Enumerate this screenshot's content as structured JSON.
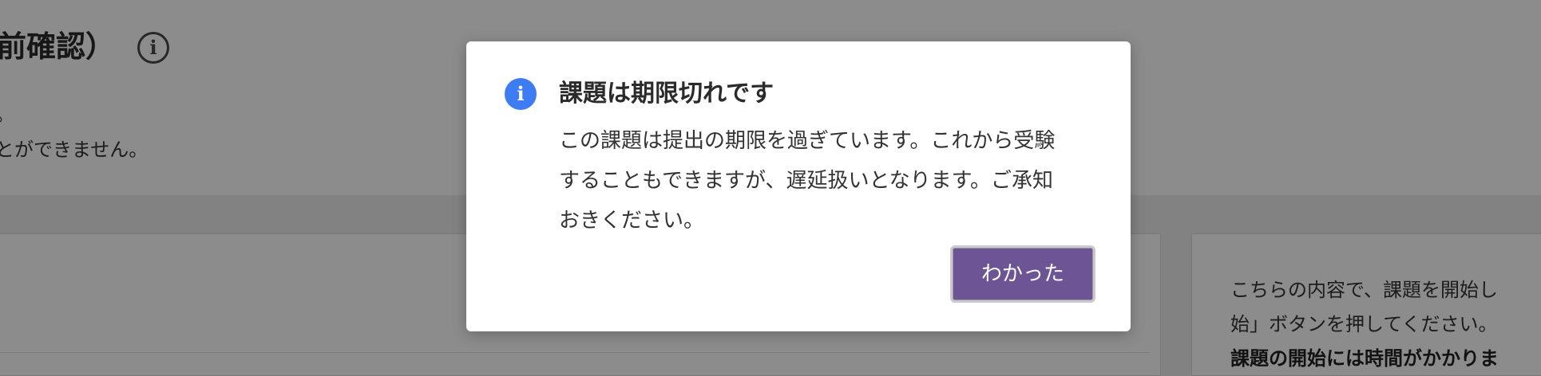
{
  "page": {
    "title": "前確認）",
    "header_line_1": "。",
    "header_line_2": "とができません。",
    "right_panel": {
      "line_1": "こちらの内容で、課題を開始し",
      "line_2": "始」ボタンを押してください。",
      "line_3": "課題の開始には時間がかかりま"
    }
  },
  "modal": {
    "icon": "info-icon",
    "title": "課題は期限切れです",
    "body_lines": [
      "この課題は提出の期限を過ぎています。これから受験",
      "することもできますが、遅延扱いとなります。ご承知",
      "おきください。"
    ],
    "ok_label": "わかった"
  },
  "colors": {
    "accent_button": "#6d5494",
    "info_icon": "#3d7cf2",
    "overlay": "rgba(0,0,0,0.45)"
  }
}
